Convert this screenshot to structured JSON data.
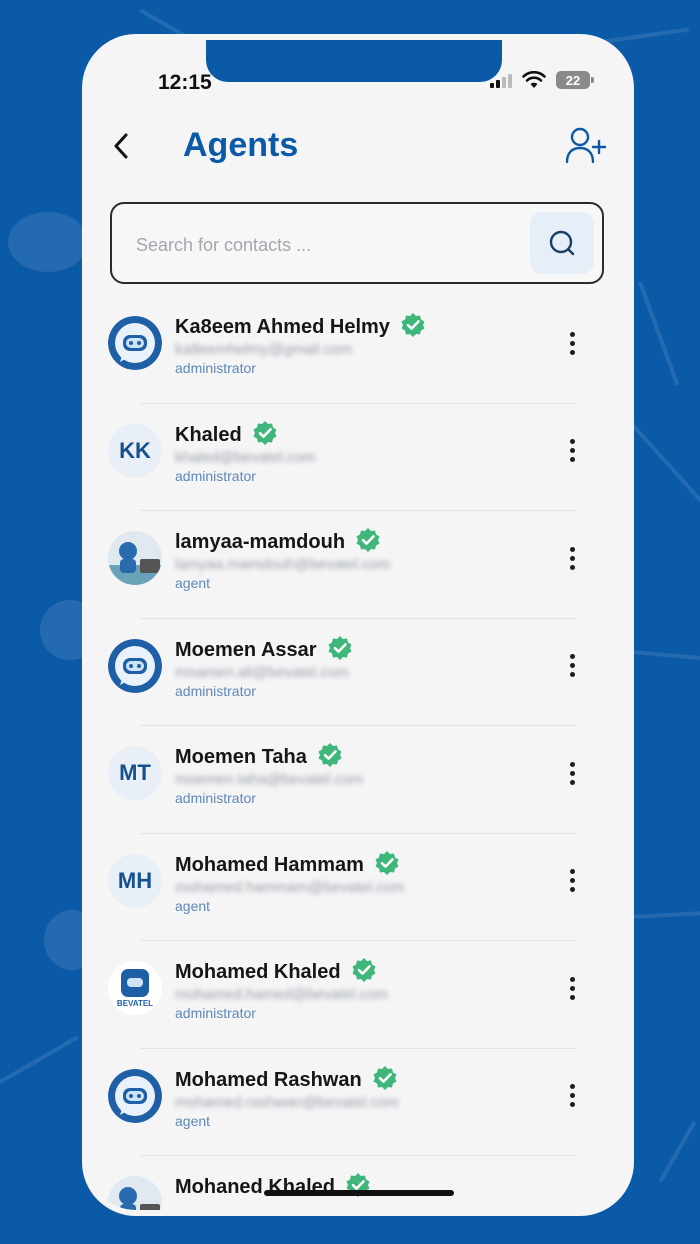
{
  "status_bar": {
    "time": "12:15",
    "battery": "22"
  },
  "header": {
    "title": "Agents",
    "back_icon": "chevron-left-icon",
    "add_icon": "add-user-icon"
  },
  "search": {
    "placeholder": "Search for contacts ...",
    "value": "",
    "icon": "search-icon"
  },
  "agents": [
    {
      "name": "Ka8eem Ahmed Helmy",
      "email": "ka8eemhelmy@gmail.com",
      "role": "administrator",
      "avatar": "bot",
      "initials": ""
    },
    {
      "name": "Khaled",
      "email": "khaled@bevatel.com",
      "role": "administrator",
      "avatar": "initials",
      "initials": "KK"
    },
    {
      "name": "lamyaa-mamdouh",
      "email": "lamyaa.mamdouh@bevatel.com",
      "role": "agent",
      "avatar": "photo",
      "initials": ""
    },
    {
      "name": "Moemen Assar",
      "email": "moamen.ali@bevatel.com",
      "role": "administrator",
      "avatar": "bot",
      "initials": ""
    },
    {
      "name": "Moemen Taha",
      "email": "moemen.taha@bevatel.com",
      "role": "administrator",
      "avatar": "initials",
      "initials": "MT"
    },
    {
      "name": "Mohamed Hammam",
      "email": "mohamed.hammam@bevatel.com",
      "role": "agent",
      "avatar": "initials",
      "initials": "MH"
    },
    {
      "name": "Mohamed Khaled",
      "email": "mohamed.hamed@bevatel.com",
      "role": "administrator",
      "avatar": "logo",
      "initials": "",
      "logo_text": "BEVATEL"
    },
    {
      "name": "Mohamed Rashwan",
      "email": "mohamed.rashwan@bevatel.com",
      "role": "agent",
      "avatar": "bot",
      "initials": ""
    },
    {
      "name": "Mohaned Khaled",
      "email": "",
      "role": "",
      "avatar": "photo",
      "initials": ""
    }
  ],
  "colors": {
    "brand": "#0b5aa8",
    "verified": "#3fb67a",
    "role": "#5f88b8"
  }
}
